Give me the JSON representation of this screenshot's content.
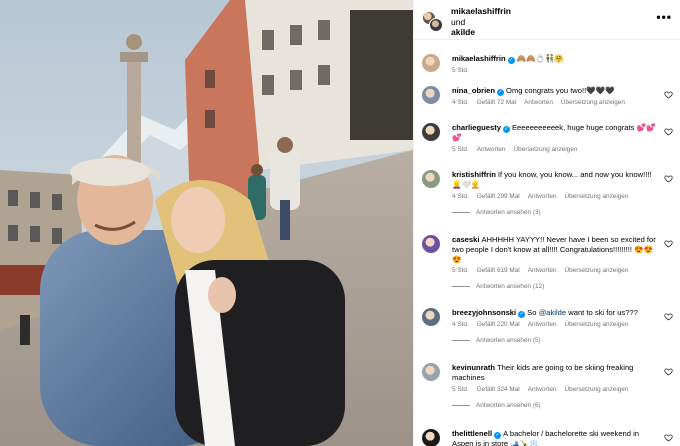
{
  "post": {
    "author": "mikaelashiffrin",
    "coauthor_conjunction": "und",
    "coauthor": "akilde",
    "more_label": "•••"
  },
  "comments": [
    {
      "user": "mikaelashiffrin",
      "verified": true,
      "text": "🙈🙈💍👬🤗",
      "time": "5 Std.",
      "likes": "",
      "reply_label": "",
      "translate_label": "",
      "replies": "",
      "avatar_color": "#c9a98a"
    },
    {
      "user": "nina_obrien",
      "verified": true,
      "text": "Omg congrats you two!!🖤🖤🖤",
      "time": "4 Std.",
      "likes": "Gefällt 72 Mal",
      "reply_label": "Antworten",
      "translate_label": "Übersetzung anzeigen",
      "replies": "",
      "avatar_color": "#7a8fa6"
    },
    {
      "user": "charlieguesty",
      "verified": true,
      "text": "Eeeeeeeeeeek, huge huge congrats 💕💕💕",
      "time": "5 Std.",
      "likes": "",
      "reply_label": "Antworten",
      "translate_label": "Übersetzung anzeigen",
      "replies": "",
      "avatar_color": "#3c3c3c"
    },
    {
      "user": "kristishiffrin",
      "verified": false,
      "text": "If you know, you know... and now you know!!!! 👱‍♀️🤍👱",
      "time": "4 Std.",
      "likes": "Gefällt 299 Mal",
      "reply_label": "Antworten",
      "translate_label": "Übersetzung anzeigen",
      "replies": "Antworten ansehen (3)",
      "avatar_color": "#8a9a7e"
    },
    {
      "user": "caseski",
      "verified": false,
      "text": "AHHHHH YAYYY!! Never have I been so excited for two people I don't know at all!!!! Congratulations!!!!!!!!! 😍😍😍",
      "time": "5 Std.",
      "likes": "Gefällt 619 Mal",
      "reply_label": "Antworten",
      "translate_label": "Übersetzung anzeigen",
      "replies": "Antworten ansehen (12)",
      "avatar_color": "#6e4fa0"
    },
    {
      "user": "breezyjohnsonski",
      "verified": true,
      "text": "So ",
      "mention": "@akilde",
      "text_after": " want to ski for us???",
      "time": "4 Std.",
      "likes": "Gefällt 220 Mal",
      "reply_label": "Antworten",
      "translate_label": "Übersetzung anzeigen",
      "replies": "Antworten ansehen (5)",
      "avatar_color": "#5a6f82"
    },
    {
      "user": "kevinunrath",
      "verified": false,
      "text": "Their kids are going to be skiing freaking machines",
      "time": "5 Std.",
      "likes": "Gefällt 324 Mal",
      "reply_label": "Antworten",
      "translate_label": "Übersetzung anzeigen",
      "replies": "Antworten ansehen (6)",
      "avatar_color": "#9aa2ab"
    },
    {
      "user": "thelittlenell",
      "verified": true,
      "text": "A bachelor / bachelorette ski weekend in Aspen is in store 🎿🍾❄️",
      "time": "",
      "likes": "",
      "reply_label": "",
      "translate_label": "",
      "replies": "",
      "avatar_color": "#1a1a1a"
    }
  ],
  "colors": {
    "verified": "#0095f6",
    "meta_text": "#737373",
    "divider": "#efefef"
  }
}
